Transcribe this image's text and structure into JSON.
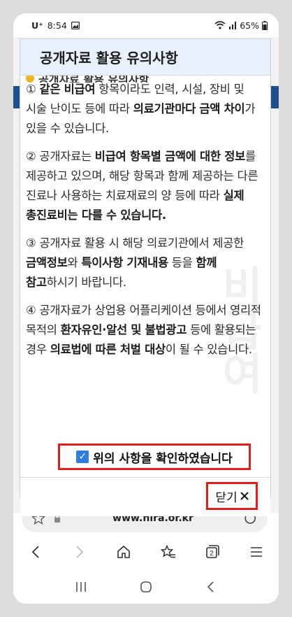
{
  "status": {
    "carrier": "U⁺",
    "time": "8:54",
    "battery": "65%"
  },
  "modal": {
    "title": "공개자료 활용 유의사항",
    "partial_heading": "공개자료 활용 유의사항",
    "paragraphs": [
      [
        {
          "t": "① ",
          "b": false
        },
        {
          "t": "같은 비급여",
          "b": true
        },
        {
          "t": " 항목이라도 인력, 시설, 장비 및 시술 난이도 등에 따라 ",
          "b": false
        },
        {
          "t": "의료기관마다 금액 차이",
          "b": true
        },
        {
          "t": "가 있을 수 있습니다.",
          "b": false
        }
      ],
      [
        {
          "t": "② 공개자료는 ",
          "b": false
        },
        {
          "t": "비급여 항목별 금액에 대한 정보",
          "b": true
        },
        {
          "t": "를 제공하고 있으며, 해당 항목과 함께 제공하는 다른 진료나 사용하는 치료재료의 양 등에 따라 ",
          "b": false
        },
        {
          "t": "실제 총진료비는 다를 수 있습니다.",
          "b": true
        }
      ],
      [
        {
          "t": "③ 공개자료 활용 시 해당 의료기관에서 제공한 ",
          "b": false
        },
        {
          "t": "금액정보",
          "b": true
        },
        {
          "t": "와 ",
          "b": false
        },
        {
          "t": "특이사항 기재내용",
          "b": true
        },
        {
          "t": " 등을 ",
          "b": false
        },
        {
          "t": "함께 참고",
          "b": true
        },
        {
          "t": "하시기 바랍니다.",
          "b": false
        }
      ],
      [
        {
          "t": "④ 공개자료가 상업용 어플리케이션 등에서 영리적 목적의 ",
          "b": false
        },
        {
          "t": "환자유인·알선 및 불법광고",
          "b": true
        },
        {
          "t": " 등에 활용되는 경우 ",
          "b": false
        },
        {
          "t": "의료법에 따른 처벌 대상",
          "b": true
        },
        {
          "t": "이 될 수 있습니다.",
          "b": false
        }
      ]
    ],
    "confirm_label": "위의 사항을 확인하였습니다",
    "confirm_checked": true,
    "close_label": "닫기"
  },
  "browser": {
    "url": "www.hira.or.kr",
    "tab_count": "2"
  },
  "colors": {
    "header_bg": "#e8f1fb",
    "highlight_border": "#e01e1e",
    "checkbox": "#2f7de1"
  }
}
